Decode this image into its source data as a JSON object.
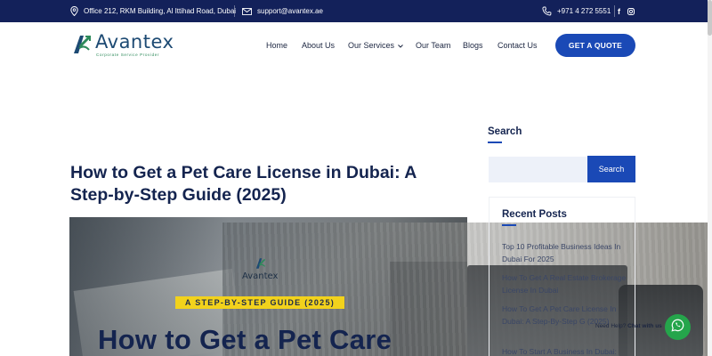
{
  "topbar": {
    "address": "Office 212, RKM Building, Al Ittihad Road, Dubai",
    "email": "support@avantex.ae",
    "phone": "+971 4 272 5551",
    "social": {
      "facebook": "f",
      "instagram": "instagram-icon"
    }
  },
  "brand": {
    "name": "Avantex",
    "tagline": "Corporate Service Provider"
  },
  "nav": {
    "home": "Home",
    "about": "About Us",
    "services": "Our Services",
    "team": "Our Team",
    "blogs": "Blogs",
    "contact": "Contact Us",
    "cta": "GET A QUOTE"
  },
  "article": {
    "title": "How to Get a Pet Care License in Dubai: A Step-by-Step Guide (2025)",
    "hero_logo": "Avantex",
    "hero_badge": "A STEP-BY-STEP GUIDE (2025)",
    "hero_headline": "How to Get a Pet Care"
  },
  "sidebar": {
    "search_title": "Search",
    "search_placeholder": "",
    "search_button": "Search",
    "recent_title": "Recent Posts",
    "recent": [
      "Top 10 Profitable Business Ideas In Dubai For 2025",
      "How To Get A Real Estate Brokerage License In Dubai",
      "How To Get A Pet Care License In Dubai: A Step-By-Step G (2025)",
      "How To Start A Business In Dubai:"
    ]
  },
  "chat": {
    "prefix": "Need Help?",
    "label": "Chat with us"
  },
  "colors": {
    "navy": "#13215a",
    "primary": "#1a49b6",
    "title": "#14244f",
    "badge": "#f2d21c",
    "whatsapp": "#25a54b"
  }
}
